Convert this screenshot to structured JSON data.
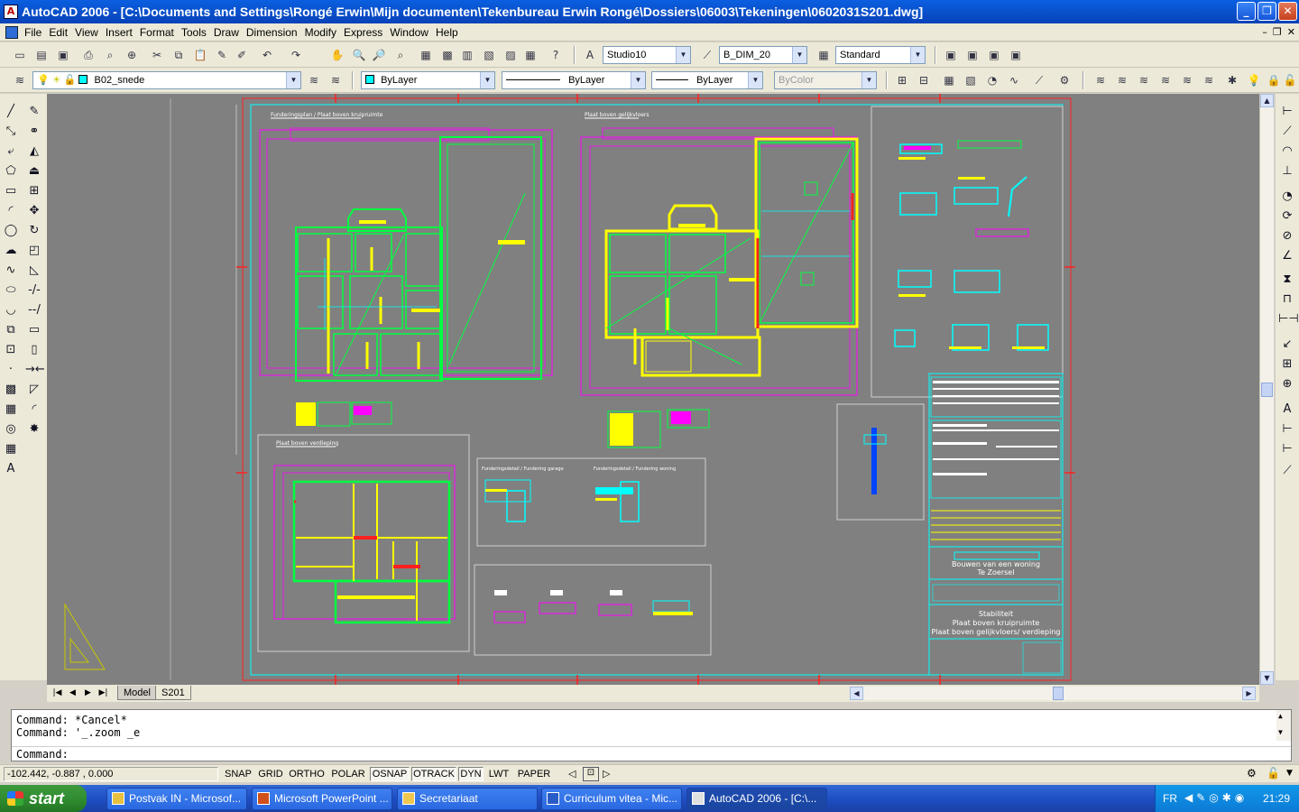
{
  "window": {
    "title": "AutoCAD 2006 - [C:\\Documents and Settings\\Rongé Erwin\\Mijn documenten\\Tekenbureau Erwin Rongé\\Dossiers\\06003\\Tekeningen\\0602031S201.dwg]"
  },
  "menu": {
    "items": [
      "File",
      "Edit",
      "View",
      "Insert",
      "Format",
      "Tools",
      "Draw",
      "Dimension",
      "Modify",
      "Express",
      "Window",
      "Help"
    ]
  },
  "toolbar1": {
    "text_style": "Studio10",
    "dim_style": "B_DIM_20",
    "table_style": "Standard"
  },
  "toolbar2": {
    "layer": "B02_snede",
    "color": "ByLayer",
    "linetype": "ByLayer",
    "lineweight": "ByLayer",
    "plot_style": "ByColor"
  },
  "drawing": {
    "sheet_titles": [
      "Funderingsplan / Plaat boven kruipruimte",
      "Plaat boven gelijkvloers",
      "Plaat boven verdieping"
    ],
    "detail_titles": [
      "Funderingsdetail / Fundering garage",
      "Funderingsdetail / Fundering woning"
    ],
    "title_block": {
      "project_line1": "Bouwen van een woning",
      "project_line2": "Te Zoersel",
      "subject_line1": "Stabiliteit",
      "subject_line2": "Plaat boven kruipruimte",
      "subject_line3": "Plaat boven gelijkvloers/ verdieping"
    }
  },
  "layout_tabs": {
    "items": [
      "Model",
      "S201"
    ],
    "active": "S201"
  },
  "command": {
    "history": [
      "Command: *Cancel*",
      "Command: '_.zoom _e"
    ],
    "prompt": "Command:"
  },
  "status": {
    "coordinates": "-102.442, -0.887 , 0.000",
    "toggles": [
      "SNAP",
      "GRID",
      "ORTHO",
      "POLAR",
      "OSNAP",
      "OTRACK",
      "DYN",
      "LWT",
      "PAPER"
    ],
    "toggles_on": [
      "OSNAP",
      "OTRACK",
      "DYN"
    ]
  },
  "taskbar": {
    "start_label": "start",
    "tasks": [
      "Postvak IN - Microsof...",
      "Microsoft PowerPoint ...",
      "Secretariaat",
      "Curriculum vitea - Mic...",
      "AutoCAD 2006 - [C:\\..."
    ],
    "active_task": 4,
    "language": "FR",
    "clock": "21:29"
  },
  "colors": {
    "model_space_bg": "#808080",
    "plan_green": "#00ff40",
    "plan_magenta": "#ff00ff",
    "plan_yellow": "#ffff00",
    "plan_cyan": "#00ffff",
    "plan_red": "#ff2020"
  }
}
